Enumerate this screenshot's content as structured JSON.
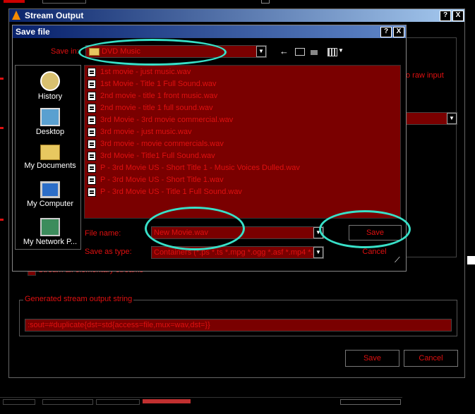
{
  "outer_window": {
    "title": "Stream Output",
    "right_label": "o raw input",
    "checkbox_label": "Stream all elementary streams",
    "group_label": "Generated stream output string",
    "output_string": ":sout=#duplicate{dst=std{access=file,mux=wav,dst=}}",
    "save_label": "Save",
    "cancel_label": "Cancel"
  },
  "dialog": {
    "title": "Save file",
    "save_in_label": "Save in:",
    "save_in_value": "DVD Music",
    "places": [
      {
        "label": "History",
        "icon": "history-icon"
      },
      {
        "label": "Desktop",
        "icon": "desktop-icon"
      },
      {
        "label": "My Documents",
        "icon": "my-documents-icon"
      },
      {
        "label": "My Computer",
        "icon": "my-computer-icon"
      },
      {
        "label": "My Network P...",
        "icon": "my-network-icon"
      }
    ],
    "files": [
      "1st movie - just music.wav",
      "1st Movie - Title 1 Full Sound.wav",
      "2nd movie - title 1 front music.wav",
      "2nd movie - title 1 full sound.wav",
      "3rd Movie - 3rd movie commercial.wav",
      "3rd movie - just music.wav",
      "3rd movie - movie commercials.wav",
      "3rd Movie - Title1 Full Sound.wav",
      "P - 3rd Movie US - Short Title 1 - Music Voices Dulled.wav",
      "P - 3rd Movie US - Short Title 1.wav",
      "P - 3rd Movie US - Title 1 Full Sound.wav"
    ],
    "file_name_label": "File name:",
    "file_name_value": "New Movie.wav",
    "save_as_type_label": "Save as type:",
    "save_as_type_value": "Containers (*.ps *.ts *.mpg *.ogg *.asf *.mp4 *.m",
    "save_label": "Save",
    "cancel_label": "Cancel",
    "help_label": "?",
    "close_label": "X"
  },
  "colors": {
    "accent_red": "#e01010",
    "field_bg": "#7a0000",
    "annotation": "#38e0c8"
  }
}
